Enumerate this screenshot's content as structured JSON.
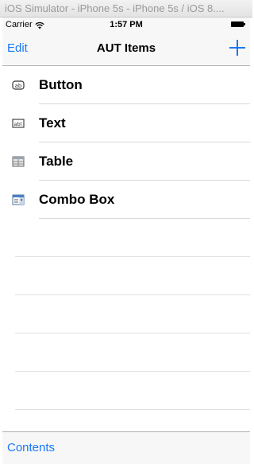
{
  "simulator": {
    "title": "iOS Simulator - iPhone 5s - iPhone 5s / iOS 8...."
  },
  "statusbar": {
    "carrier": "Carrier",
    "time": "1:57 PM"
  },
  "navbar": {
    "edit_label": "Edit",
    "title": "AUT Items",
    "add_icon": "plus-icon"
  },
  "items": [
    {
      "label": "Button",
      "icon": "button-icon"
    },
    {
      "label": "Text",
      "icon": "text-field-icon"
    },
    {
      "label": "Table",
      "icon": "table-icon"
    },
    {
      "label": "Combo Box",
      "icon": "combo-box-icon"
    }
  ],
  "toolbar": {
    "contents_label": "Contents"
  },
  "colors": {
    "accent": "#1a78f5",
    "bar_bg": "#f7f7f8",
    "separator": "#d9d9d9"
  }
}
